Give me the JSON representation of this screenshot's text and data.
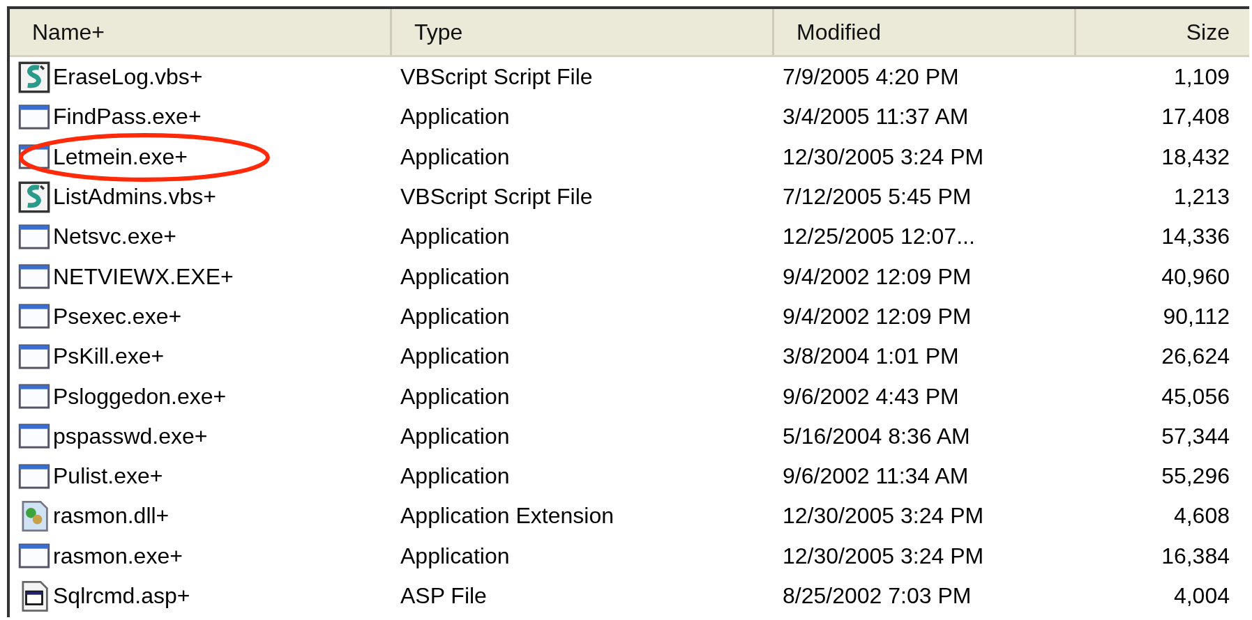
{
  "table": {
    "columns": [
      "Name+",
      "Type",
      "Modified",
      "Size"
    ],
    "rows": [
      {
        "kind": "script",
        "name": "EraseLog.vbs+",
        "type": "VBScript Script File",
        "modified": "7/9/2005 4:20 PM",
        "size": "1,109",
        "circled": false
      },
      {
        "kind": "app",
        "name": "FindPass.exe+",
        "type": "Application",
        "modified": "3/4/2005 11:37 AM",
        "size": "17,408",
        "circled": false
      },
      {
        "kind": "app",
        "name": "Letmein.exe+",
        "type": "Application",
        "modified": "12/30/2005 3:24 PM",
        "size": "18,432",
        "circled": true
      },
      {
        "kind": "script",
        "name": "ListAdmins.vbs+",
        "type": "VBScript Script File",
        "modified": "7/12/2005 5:45 PM",
        "size": "1,213",
        "circled": false
      },
      {
        "kind": "app",
        "name": "Netsvc.exe+",
        "type": "Application",
        "modified": "12/25/2005 12:07...",
        "size": "14,336",
        "circled": false
      },
      {
        "kind": "app",
        "name": "NETVIEWX.EXE+",
        "type": "Application",
        "modified": "9/4/2002 12:09 PM",
        "size": "40,960",
        "circled": false
      },
      {
        "kind": "app",
        "name": "Psexec.exe+",
        "type": "Application",
        "modified": "9/4/2002 12:09 PM",
        "size": "90,112",
        "circled": false
      },
      {
        "kind": "app",
        "name": "PsKill.exe+",
        "type": "Application",
        "modified": "3/8/2004 1:01 PM",
        "size": "26,624",
        "circled": false
      },
      {
        "kind": "app",
        "name": "Psloggedon.exe+",
        "type": "Application",
        "modified": "9/6/2002 4:43 PM",
        "size": "45,056",
        "circled": false
      },
      {
        "kind": "app",
        "name": "pspasswd.exe+",
        "type": "Application",
        "modified": "5/16/2004 8:36 AM",
        "size": "57,344",
        "circled": false
      },
      {
        "kind": "app",
        "name": "Pulist.exe+",
        "type": "Application",
        "modified": "9/6/2002 11:34 AM",
        "size": "55,296",
        "circled": false
      },
      {
        "kind": "dll",
        "name": "rasmon.dll+",
        "type": "Application Extension",
        "modified": "12/30/2005 3:24 PM",
        "size": "4,608",
        "circled": false
      },
      {
        "kind": "app",
        "name": "rasmon.exe+",
        "type": "Application",
        "modified": "12/30/2005 3:24 PM",
        "size": "16,384",
        "circled": false
      },
      {
        "kind": "asp",
        "name": "Sqlrcmd.asp+",
        "type": "ASP File",
        "modified": "8/25/2002 7:03 PM",
        "size": "4,004",
        "circled": false
      }
    ]
  }
}
